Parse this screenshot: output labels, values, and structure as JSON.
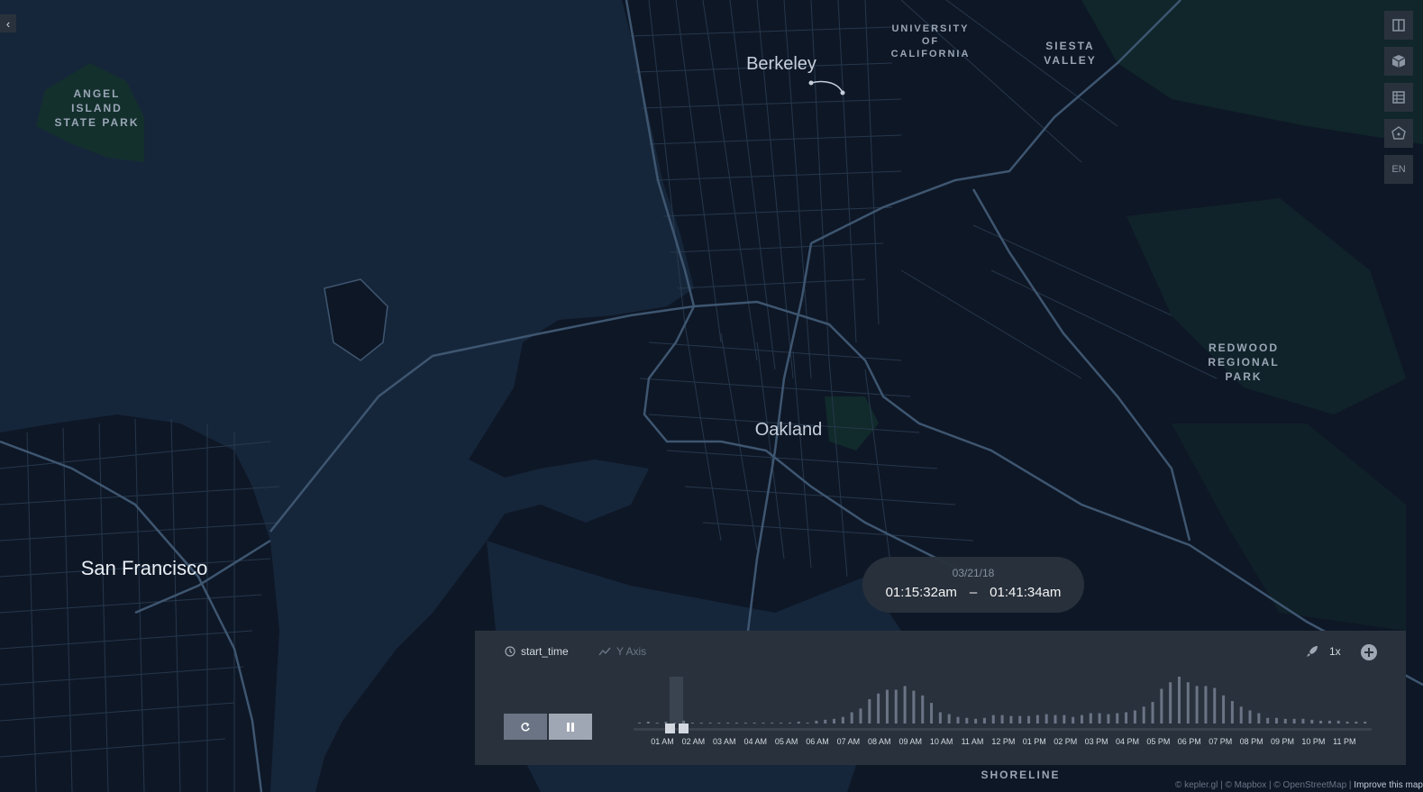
{
  "map": {
    "colors": {
      "water": "#16263a",
      "land": "#0e1726",
      "roads": "#3e5670",
      "park": "#13302d"
    },
    "labels": {
      "angel_island": "ANGEL\nISLAND\nSTATE PARK",
      "university": "UNIVERSITY OF\nCALIFORNIA",
      "siesta_valley": "SIESTA\nVALLEY",
      "berkeley": "Berkeley",
      "redwood": "REDWOOD\nREGIONAL\nPARK",
      "oakland": "Oakland",
      "san_francisco": "San Francisco",
      "shoreline": "SHORELINE"
    }
  },
  "sidebar": {
    "toggle_icon": "chevron-left-icon"
  },
  "map_controls": {
    "buttons": [
      {
        "name": "split-map-button",
        "icon": "split-map-icon"
      },
      {
        "name": "3d-map-button",
        "icon": "cube-icon"
      },
      {
        "name": "data-table-button",
        "icon": "table-icon"
      },
      {
        "name": "draw-polygon-button",
        "icon": "polygon-icon"
      }
    ],
    "locale": "EN"
  },
  "time_display": {
    "date": "03/21/18",
    "start": "01:15:32am",
    "separator": "–",
    "end": "01:41:34am"
  },
  "timeline": {
    "field_icon": "clock-icon",
    "field": "start_time",
    "y_axis_icon": "line-chart-icon",
    "y_axis": "Y Axis",
    "speed_icon": "rocket-icon",
    "speed": "1x",
    "settings_icon": "settings-icon",
    "reset_icon": "reset-icon",
    "pause_icon": "pause-icon",
    "accent": "#a0a7b4"
  },
  "chart_data": {
    "type": "bar",
    "categories": [
      "01 AM",
      "02 AM",
      "03 AM",
      "04 AM",
      "05 AM",
      "06 AM",
      "07 AM",
      "08 AM",
      "09 AM",
      "10 AM",
      "11 AM",
      "12 PM",
      "01 PM",
      "02 PM",
      "03 PM",
      "04 PM",
      "05 PM",
      "06 PM",
      "07 PM",
      "08 PM",
      "09 PM",
      "10 PM",
      "11 PM"
    ],
    "values": [
      1,
      2,
      0,
      2,
      0,
      3,
      0,
      0,
      1,
      0,
      0,
      0,
      0,
      1,
      0,
      0,
      1,
      1,
      2,
      1,
      3,
      4,
      5,
      7,
      12,
      16,
      26,
      32,
      36,
      36,
      40,
      35,
      30,
      22,
      12,
      10,
      7,
      6,
      5,
      6,
      9,
      9,
      8,
      8,
      8,
      9,
      10,
      9,
      9,
      7,
      9,
      11,
      11,
      10,
      11,
      12,
      14,
      18,
      23,
      37,
      44,
      50,
      44,
      40,
      40,
      38,
      30,
      24,
      18,
      14,
      11,
      6,
      6,
      5,
      5,
      5,
      4,
      3,
      3,
      3,
      2,
      2,
      2
    ],
    "xlabel": "",
    "ylabel": "",
    "selected_range": [
      "01:15:32am",
      "01:41:34am"
    ]
  },
  "attribution": {
    "kepler": "© kepler.gl",
    "mapbox": "© Mapbox",
    "osm": "© OpenStreetMap",
    "improve": "Improve this map"
  }
}
